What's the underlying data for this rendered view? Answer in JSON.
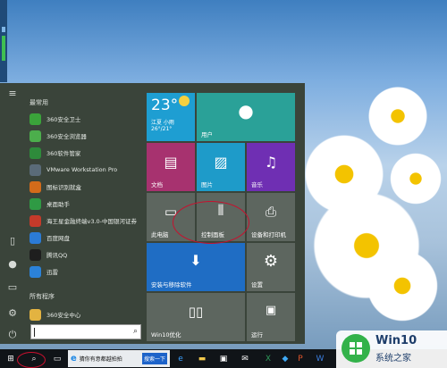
{
  "colors": {
    "menu_bg": "#3a443a",
    "tile_teal": "#2aa198",
    "tile_purple": "#a7326f",
    "tile_photo": "#1e9bc9",
    "tile_music": "#6f2fb3",
    "tile_store": "#1f6dc4",
    "tile_gray": "#5d665f",
    "taskbar": "#101418",
    "annotation": "#c8102e"
  },
  "app_list": {
    "frequent_heading": "最常用",
    "frequent": [
      {
        "label": "360安全卫士",
        "icon": "shield-icon",
        "color": "#3aa33a"
      },
      {
        "label": "360安全浏览器",
        "icon": "browser-icon",
        "color": "#4cae4c"
      },
      {
        "label": "360软件管家",
        "icon": "software-manager-icon",
        "color": "#2e8b3b"
      },
      {
        "label": "VMware Workstation Pro",
        "icon": "vmware-icon",
        "color": "#5a6b78"
      },
      {
        "label": "图标识别就盒",
        "icon": "recognition-icon",
        "color": "#d36b1a"
      },
      {
        "label": "桌面助手",
        "icon": "desktop-assistant-icon",
        "color": "#2f9a44"
      },
      {
        "label": "海王星金融终端v3.0-中国银河证券",
        "icon": "finance-terminal-icon",
        "color": "#c43a2a"
      },
      {
        "label": "百度网盘",
        "icon": "cloud-drive-icon",
        "color": "#2b7bd6"
      },
      {
        "label": "腾讯QQ",
        "icon": "qq-icon",
        "color": "#1e1e1e"
      },
      {
        "label": "迅雷",
        "icon": "thunder-icon",
        "color": "#2b82d9"
      }
    ],
    "all_programs_heading": "所有程序",
    "all_programs": [
      {
        "label": "360安全中心",
        "icon": "folder-icon",
        "color": "#e3b341"
      }
    ]
  },
  "tiles": {
    "weather": {
      "temp": "23°",
      "condition": "江夏 小雨",
      "range": "26°/21°"
    },
    "user": {
      "label": "用户"
    },
    "documents": {
      "label": "文档"
    },
    "pictures": {
      "label": "图片"
    },
    "music": {
      "label": "音乐"
    },
    "this_pc": {
      "label": "此电脑"
    },
    "control_panel": {
      "label": "控制面板"
    },
    "devices_printers": {
      "label": "设备和打印机"
    },
    "store": {
      "label": "安装与移除软件"
    },
    "settings": {
      "label": "设置"
    },
    "win10_optimize": {
      "label": "Win10优化"
    },
    "run": {
      "label": "运行"
    }
  },
  "taskbar": {
    "ie_window_label": "猜你有意都越拍拍",
    "search_label": "搜索一下"
  },
  "watermark": {
    "title": "Win10",
    "subtitle": "系统之家"
  }
}
